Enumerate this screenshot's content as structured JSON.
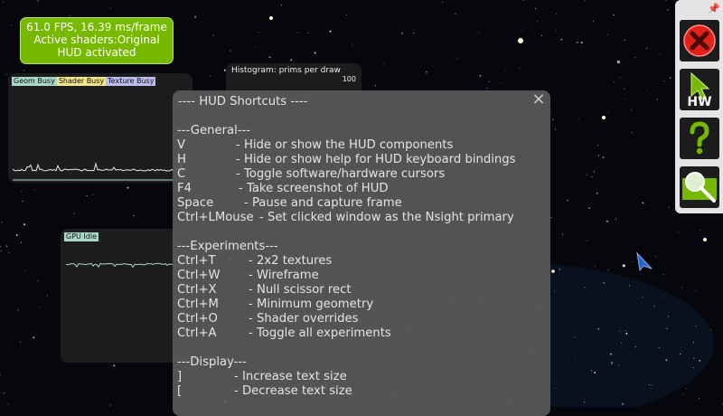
{
  "hud": {
    "fps_line": "61.0 FPS, 16.39 ms/frame",
    "shaders_line": "Active shaders:Original",
    "status_line": "HUD activated"
  },
  "graphs": {
    "busy": {
      "tags": [
        {
          "label": "Geom Busy",
          "color": "#a9d8c8"
        },
        {
          "label": "Shader Busy",
          "color": "#f3e58a"
        },
        {
          "label": "Texture Busy",
          "color": "#bcbcf0"
        }
      ]
    },
    "histogram": {
      "title": "Histogram: prims per draw",
      "value": "100"
    },
    "gpu_idle": {
      "tag": "GPU Idle",
      "color": "#a9d8c8"
    }
  },
  "shortcuts": {
    "title": "---- HUD Shortcuts ----",
    "close_symbol": "×",
    "sections": [
      {
        "heading": "---General---",
        "items": [
          {
            "key": "V",
            "desc": "- Hide or show the HUD components"
          },
          {
            "key": "H",
            "desc": "- Hide or show help for HUD keyboard bindings"
          },
          {
            "key": "C",
            "desc": "- Toggle software/hardware cursors"
          },
          {
            "key": "F4",
            "desc": "- Take screenshot of HUD"
          },
          {
            "key": "Space",
            "desc": "- Pause and capture frame"
          },
          {
            "key": "Ctrl+LMouse",
            "desc": "- Set clicked window as the Nsight primary"
          }
        ]
      },
      {
        "heading": "---Experiments---",
        "items": [
          {
            "key": "Ctrl+T",
            "desc": "- 2x2 textures"
          },
          {
            "key": "Ctrl+W",
            "desc": "- Wireframe"
          },
          {
            "key": "Ctrl+X",
            "desc": "- Null scissor rect"
          },
          {
            "key": "Ctrl+M",
            "desc": "- Minimum geometry"
          },
          {
            "key": "Ctrl+O",
            "desc": "- Shader overrides"
          },
          {
            "key": "Ctrl+A",
            "desc": "- Toggle all experiments"
          }
        ]
      },
      {
        "heading": "---Display---",
        "items": [
          {
            "key": "]",
            "desc": "- Increase text size"
          },
          {
            "key": "[",
            "desc": "- Decrease text size"
          }
        ]
      }
    ]
  },
  "toolbar": {
    "hw_label": "HW",
    "icons": [
      "pin-icon",
      "close-circle-icon",
      "cursor-hw-icon",
      "help-question-icon",
      "magnifier-icon"
    ]
  },
  "colors": {
    "accent_green": "#76b900",
    "close_red": "#e0221b",
    "panel_gray": "#585858"
  }
}
